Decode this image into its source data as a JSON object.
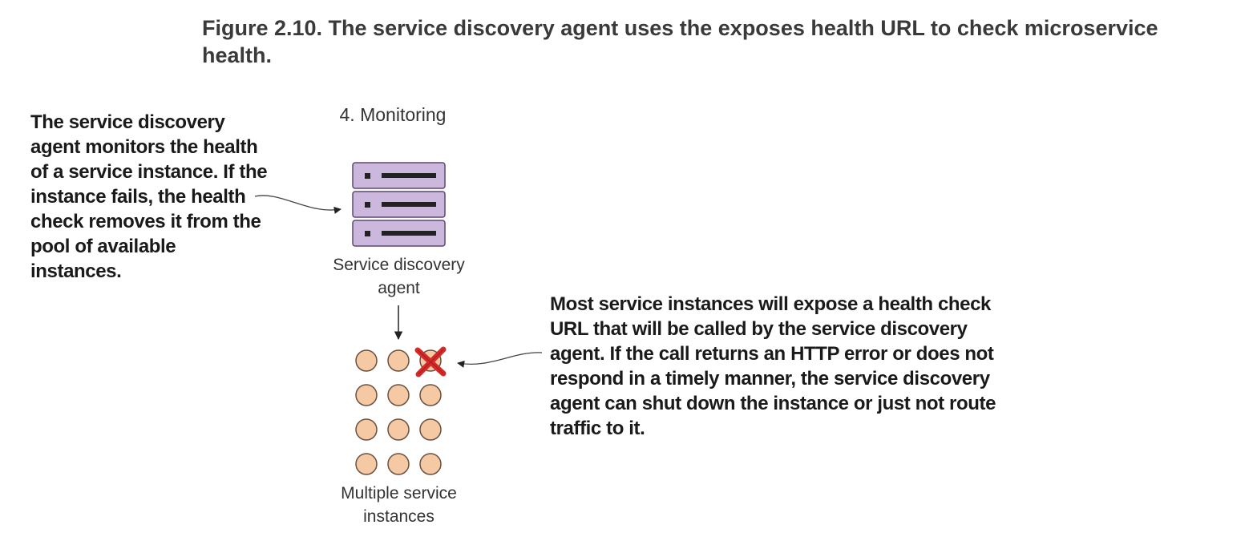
{
  "figure": {
    "caption": "Figure 2.10. The service discovery agent uses the exposes health URL to check microservice health."
  },
  "diagram": {
    "step_title": "4. Monitoring",
    "agent_label_line1": "Service discovery",
    "agent_label_line2": "agent",
    "instances_label_line1": "Multiple service",
    "instances_label_line2": "instances",
    "left_note": "The service discovery agent monitors the health of a service instance. If the instance fails, the health check removes it from the pool of available instances.",
    "right_note": "Most service instances will expose a health check URL that will be called by the service discovery agent. If the call returns an HTTP error or does not respond in a timely manner, the service discovery agent can shut down the instance or just not route traffic to it."
  },
  "colors": {
    "server_fill": "#cbb8dc",
    "server_stroke": "#5a4870",
    "instance_fill": "#f5c9a3",
    "instance_stroke": "#6a5040",
    "failed_mark": "#d42a2a"
  },
  "icons": {
    "server": "server-stack-icon",
    "instance": "service-instance-icon",
    "failure": "red-x-icon"
  }
}
